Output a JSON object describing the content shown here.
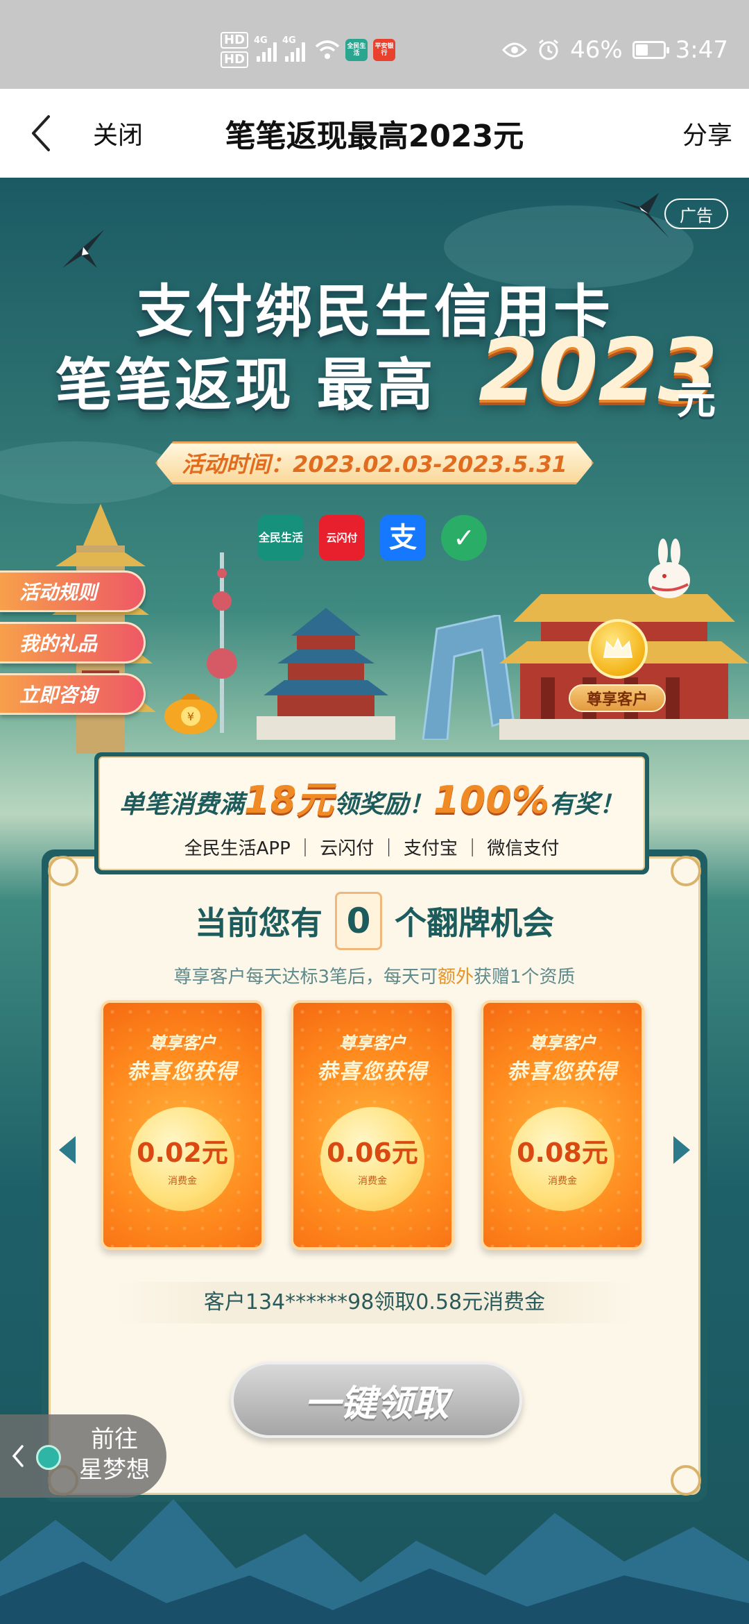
{
  "status_bar": {
    "hd1": "HD",
    "hd2": "HD",
    "net1": "4G",
    "net2": "4G",
    "app1": "全民生活",
    "app2": "平安银行",
    "battery_percent": "46%",
    "battery_level": 0.46,
    "time": "3:47"
  },
  "nav": {
    "close_label": "关闭",
    "title": "笔笔返现最高2023元",
    "share_label": "分享"
  },
  "hero": {
    "ad_label": "广告",
    "line1": "支付绑民生信用卡",
    "line2": "笔笔返现 最高",
    "amount": "2023",
    "unit": "元",
    "period": "活动时间：2023.02.03-2023.5.31",
    "pay_icons": [
      "全民生活",
      "云闪付",
      "支",
      "✓"
    ]
  },
  "side_tabs": {
    "rules": "活动规则",
    "gifts": "我的礼品",
    "consult": "立即咨询"
  },
  "vip": {
    "label": "尊享客户"
  },
  "rules_banner": {
    "prefix": "单笔消费满",
    "min_amount": "18元",
    "middle": "领奖励！",
    "percent": "100%",
    "suffix": "有奖！",
    "channels": "全民生活APP ｜ 云闪付 ｜ 支付宝 ｜ 微信支付"
  },
  "flip": {
    "prefix": "当前您有",
    "count": "0",
    "suffix": "个翻牌机会",
    "note_pre": "尊享客户每天达标3笔后，每天可",
    "note_hl": "额外",
    "note_post": "获赠1个资质"
  },
  "cards": [
    {
      "line1": "尊享客户",
      "line2": "恭喜您获得",
      "amount": "0.02元",
      "unit": "消费金"
    },
    {
      "line1": "尊享客户",
      "line2": "恭喜您获得",
      "amount": "0.06元",
      "unit": "消费金"
    },
    {
      "line1": "尊享客户",
      "line2": "恭喜您获得",
      "amount": "0.08元",
      "unit": "消费金"
    }
  ],
  "recent_claim": "客户134******98领取0.58元消费金",
  "claim_button": "一键领取",
  "float_back": {
    "line1": "前往",
    "line2": "星梦想"
  },
  "colors": {
    "accent_orange": "#f08a24",
    "teal": "#1f5e63",
    "claim_disabled": "#a5a5a5"
  }
}
